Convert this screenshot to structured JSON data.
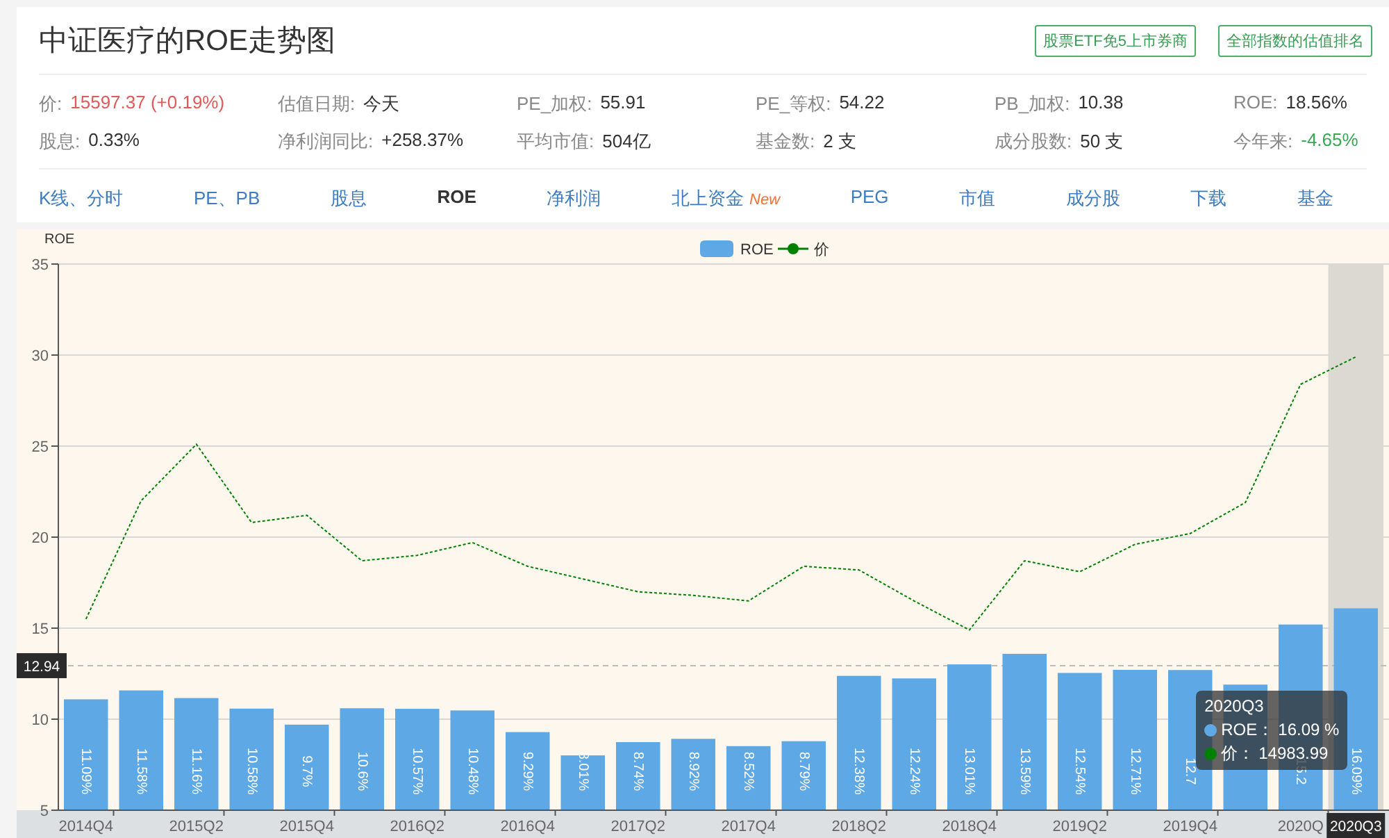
{
  "header": {
    "title": "中证医疗的ROE走势图",
    "buttons": [
      "股票ETF免5上市券商",
      "全部指数的估值排名"
    ]
  },
  "stats": [
    {
      "label": "价:",
      "value": "15597.37 (+0.19%)",
      "color": "#e05a5a"
    },
    {
      "label": "估值日期:",
      "value": "今天"
    },
    {
      "label": "PE_加权:",
      "value": "55.91"
    },
    {
      "label": "PE_等权:",
      "value": "54.22"
    },
    {
      "label": "PB_加权:",
      "value": "10.38"
    },
    {
      "label": "ROE:",
      "value": "18.56%"
    },
    {
      "label": "股息:",
      "value": "0.33%"
    },
    {
      "label": "净利润同比:",
      "value": "+258.37%"
    },
    {
      "label": "平均市值:",
      "value": "504亿"
    },
    {
      "label": "基金数:",
      "value": "2 支"
    },
    {
      "label": "成分股数:",
      "value": "50 支"
    },
    {
      "label": "今年来:",
      "value": "-4.65%",
      "color": "#3aa757"
    }
  ],
  "nav": [
    {
      "label": "K线、分时",
      "selected": false
    },
    {
      "label": "PE、PB",
      "selected": false
    },
    {
      "label": "股息",
      "selected": false
    },
    {
      "label": "ROE",
      "selected": true
    },
    {
      "label": "净利润",
      "selected": false
    },
    {
      "label": "北上资金",
      "badge": "New",
      "selected": false
    },
    {
      "label": "PEG",
      "selected": false
    },
    {
      "label": "市值",
      "selected": false
    },
    {
      "label": "成分股",
      "selected": false
    },
    {
      "label": "下载",
      "selected": false
    },
    {
      "label": "基金",
      "selected": false
    }
  ],
  "chart": {
    "chart_data": {
      "type": "bar",
      "ylabel": "ROE",
      "ylim": [
        5,
        35
      ],
      "yticks": [
        5,
        10,
        15,
        20,
        25,
        30,
        35
      ],
      "categories": [
        "2014Q4",
        null,
        "2015Q2",
        null,
        "2015Q4",
        null,
        "2016Q2",
        null,
        "2016Q4",
        null,
        "2017Q2",
        null,
        "2017Q4",
        null,
        "2018Q2",
        null,
        "2018Q4",
        null,
        "2019Q2",
        null,
        "2019Q4",
        null,
        "2020Q",
        null
      ],
      "grid": true,
      "legend": true,
      "ref_lines": [
        {
          "axis": "y",
          "value": 12.94,
          "label": "12.94"
        }
      ],
      "series": [
        {
          "name": "ROE",
          "type": "bar",
          "color": "#5ea8e6",
          "values": [
            11.09,
            11.58,
            11.16,
            10.58,
            9.7,
            10.6,
            10.57,
            10.48,
            9.29,
            8.01,
            8.74,
            8.92,
            8.52,
            8.79,
            12.38,
            12.24,
            13.01,
            13.59,
            12.54,
            12.71,
            12.7,
            11.9,
            15.2,
            16.09
          ],
          "value_labels": [
            "11.09%",
            "11.58%",
            "11.16%",
            "10.58%",
            "9.7%",
            "10.6%",
            "10.57%",
            "10.48%",
            "9.29%",
            "8.01%",
            "8.74%",
            "8.92%",
            "8.52%",
            "8.79%",
            "12.38%",
            "12.24%",
            "13.01%",
            "13.59%",
            "12.54%",
            "12.71%",
            "12.7",
            null,
            "15.2",
            "16.09%"
          ]
        },
        {
          "name": "价",
          "type": "line",
          "line_style": "dashed",
          "color": "#008000",
          "values": [
            15.5,
            22.0,
            25.1,
            20.8,
            21.2,
            18.7,
            19.0,
            19.7,
            18.4,
            17.7,
            17.0,
            16.8,
            16.5,
            18.4,
            18.2,
            16.5,
            14.9,
            18.7,
            18.1,
            19.6,
            20.2,
            21.9,
            28.4,
            29.9
          ]
        }
      ]
    },
    "pointer": {
      "x_label": "2020Q3"
    },
    "tooltip": {
      "title": "2020Q3",
      "items": [
        {
          "name": "ROE：",
          "value": "16.09 %",
          "color": "#5ea8e6"
        },
        {
          "name": "价：",
          "value": "14983.99",
          "color": "#008000"
        }
      ]
    }
  }
}
